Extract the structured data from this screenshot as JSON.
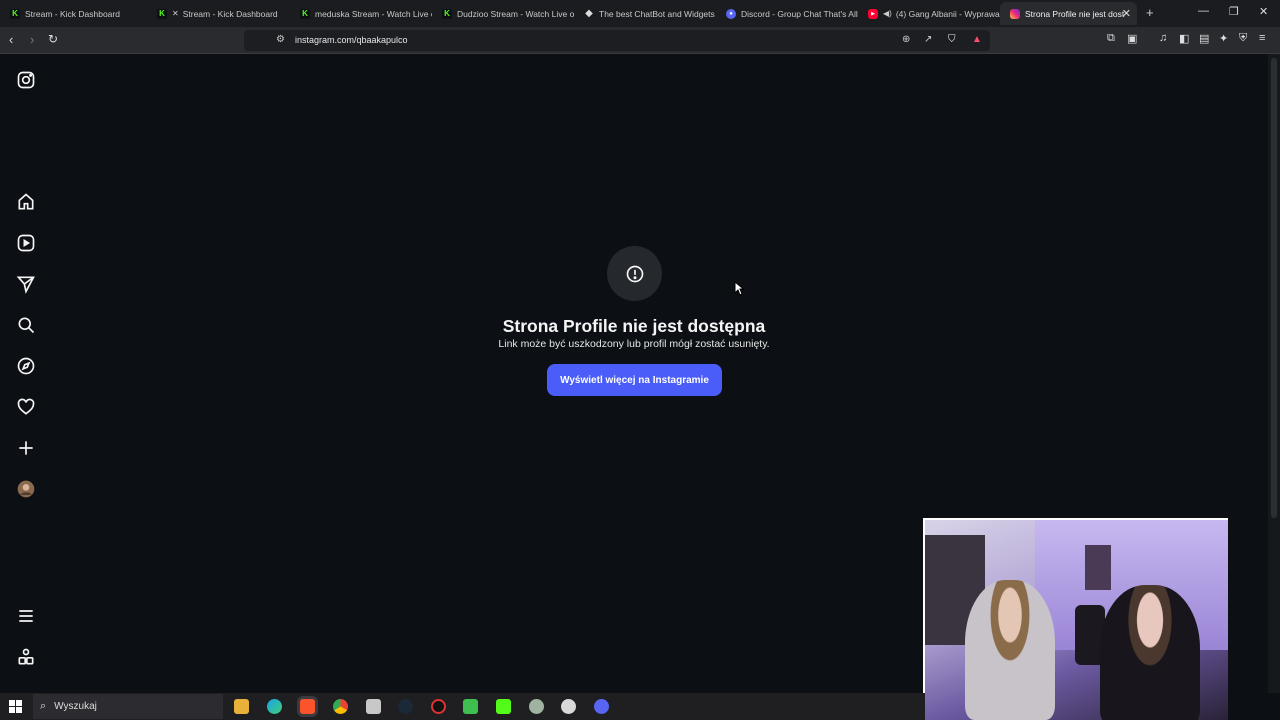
{
  "browser": {
    "tabs": [
      {
        "title": "Stream - Kick Dashboard",
        "icon": "kick-icon",
        "muted": false
      },
      {
        "title": "Stream - Kick Dashboard",
        "icon": "kick-icon",
        "muted": true
      },
      {
        "title": "meduska Stream - Watch Live o",
        "icon": "kick-icon",
        "muted": false
      },
      {
        "title": "Dudzioo Stream - Watch Live o",
        "icon": "kick-icon",
        "muted": false
      },
      {
        "title": "The best ChatBot and Widgets",
        "icon": "diamond-icon",
        "muted": false
      },
      {
        "title": "Discord - Group Chat That's All",
        "icon": "discord-icon",
        "muted": false
      },
      {
        "title": "(4) Gang Albanii - Wyprawa",
        "icon": "youtube-icon",
        "muted": false
      },
      {
        "title": "Strona Profile nie jest dost",
        "icon": "instagram-icon",
        "muted": false
      }
    ],
    "new_tab": "+",
    "url": "instagram.com/qbaakapulco"
  },
  "page": {
    "error_title": "Strona Profile nie jest dostępna",
    "error_subtitle": "Link może być uszkodzony lub profil mógł zostać usunięty.",
    "button_label": "Wyświetl więcej na Instagramie"
  },
  "sidebar": {
    "items": [
      "instagram-logo-icon",
      "home-icon",
      "reels-icon",
      "direct-icon",
      "search-icon",
      "explore-icon",
      "notifications-icon",
      "create-icon",
      "profile-avatar",
      "menu-icon",
      "apps-icon"
    ]
  },
  "taskbar": {
    "search_placeholder": "Wyszukaj"
  },
  "colors": {
    "page_bg": "#0c1014",
    "button": "#4a5df9",
    "kick": "#53fc18"
  }
}
